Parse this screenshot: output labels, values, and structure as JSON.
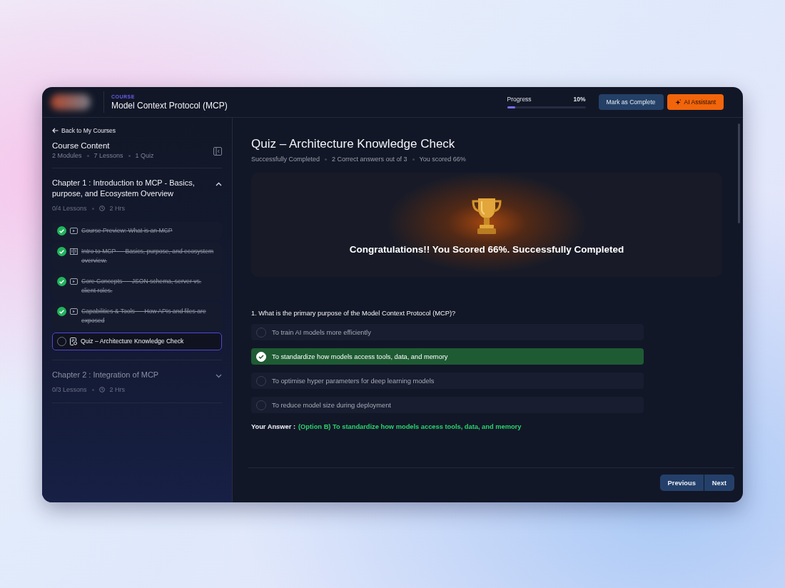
{
  "header": {
    "course_label": "COURSE",
    "course_title": "Model Context Protocol (MCP)",
    "progress_label": "Progress",
    "progress_value": "10%",
    "progress": {
      "level": 0.1
    },
    "buttons": [
      {
        "kind": "secondary",
        "label": "Mark as Complete"
      },
      {
        "kind": "assistant",
        "label": "AI Assistant"
      }
    ]
  },
  "sidebar": {
    "back_link": "Back to My Courses",
    "title": "Course Content",
    "stats": [
      "2 Modules",
      "7 Lessons",
      "1 Quiz"
    ],
    "chapters": [
      {
        "title": "Chapter 1 : Introduction to MCP -  Basics, purpose, and Ecosystem Overview",
        "lessons": "0/4 Lessons",
        "duration": "2 Hrs",
        "expanded": true,
        "items": [
          {
            "kind": "video",
            "title": "Course Preview: What is an MCP",
            "completed": true,
            "selected": false
          },
          {
            "kind": "reading",
            "title": "Intro to MCP — Basics, purpose, and ecosystem overview.",
            "completed": true,
            "selected": false
          },
          {
            "kind": "video",
            "title": "Core Concepts — JSON schema, server vs. client roles.",
            "completed": true,
            "selected": false
          },
          {
            "kind": "video",
            "title": "Capabilities & Tools — How APIs and files are exposed",
            "completed": true,
            "selected": false
          },
          {
            "kind": "quiz",
            "title": "Quiz – Architecture Knowledge Check",
            "completed": false,
            "selected": true
          }
        ]
      },
      {
        "title": "Chapter 2 : Integration of MCP",
        "lessons": "0/3 Lessons",
        "duration": "2 Hrs",
        "expanded": false
      }
    ]
  },
  "quiz": {
    "title": "Quiz – Architecture Knowledge Check",
    "meta": [
      "Successfully Completed",
      "2 Correct answers out of 3",
      "You scored 66%"
    ],
    "banner": "Congratulations!! You Scored 66%. Successfully Completed",
    "question": "1. What is the primary purpose of the Model Context Protocol (MCP)?",
    "options": [
      {
        "text": "To train AI models more efficiently",
        "selected": false
      },
      {
        "text": "To standardize how models access tools, data, and memory",
        "selected": true
      },
      {
        "text": "To optimise hyper parameters for deep learning models",
        "selected": false
      },
      {
        "text": "To reduce model size during deployment",
        "selected": false
      }
    ],
    "answer_label": "Your Answer :",
    "answer": "(Option B) To standardize how models access tools, data, and memory"
  },
  "footer": {
    "buttons": [
      "Previous",
      "Next"
    ]
  }
}
